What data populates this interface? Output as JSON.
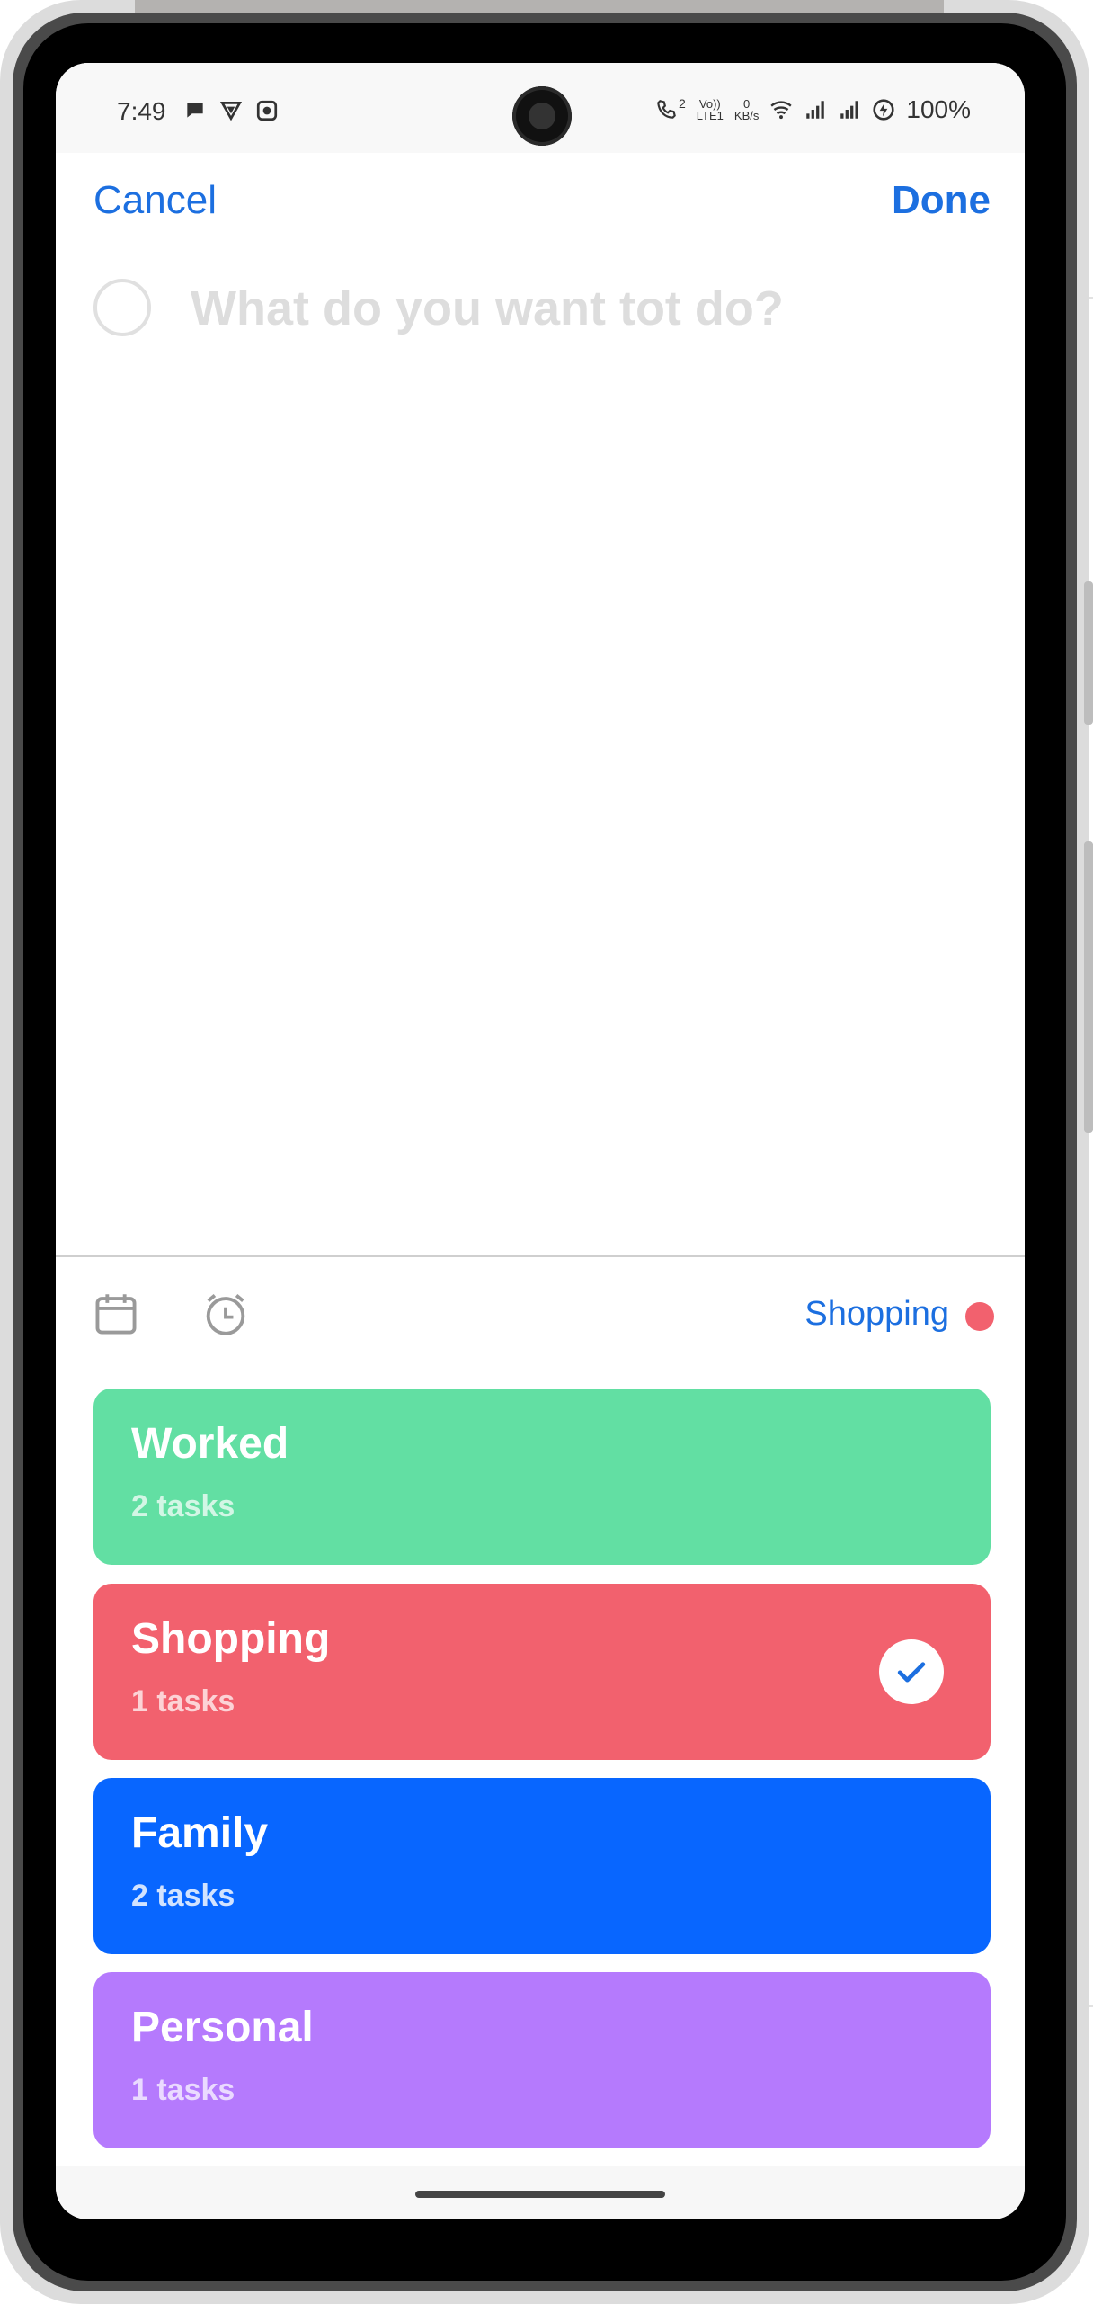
{
  "status_bar": {
    "time": "7:49",
    "data_rate_top": "0",
    "data_rate_bottom": "KB/s",
    "volte_top": "Vo))",
    "volte_bottom": "LTE1",
    "call_count": "2",
    "battery": "100%"
  },
  "header": {
    "cancel_label": "Cancel",
    "done_label": "Done"
  },
  "task": {
    "value": "",
    "placeholder": "What do you want tot do?"
  },
  "toolbar": {
    "selected_list": "Shopping",
    "selected_list_color": "#f2616e",
    "icons": [
      "calendar-icon",
      "alarm-clock-icon"
    ]
  },
  "lists": [
    {
      "title": "Worked",
      "subtitle": "2 tasks",
      "color": "#62dfa3",
      "selected": false
    },
    {
      "title": "Shopping",
      "subtitle": "1 tasks",
      "color": "#f2616e",
      "selected": true
    },
    {
      "title": "Family",
      "subtitle": "2 tasks",
      "color": "#0866ff",
      "selected": false
    },
    {
      "title": "Personal",
      "subtitle": "1 tasks",
      "color": "#b57afd",
      "selected": false
    }
  ],
  "colors": {
    "accent": "#1c6fe0",
    "check_mark": "#1c6fe0"
  }
}
